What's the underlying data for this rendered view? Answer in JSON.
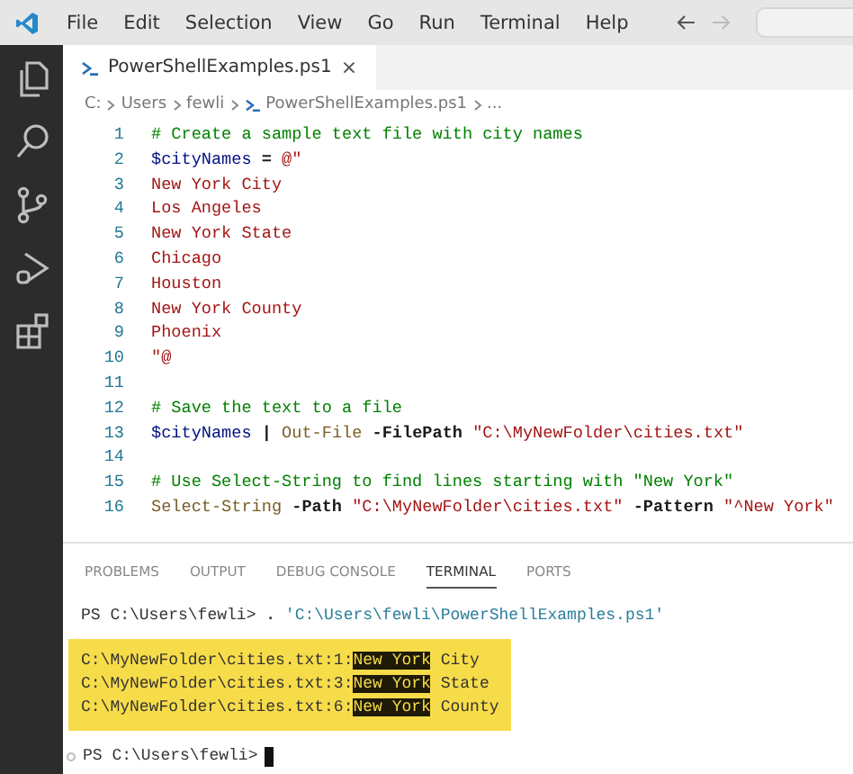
{
  "menu": {
    "items": [
      "File",
      "Edit",
      "Selection",
      "View",
      "Go",
      "Run",
      "Terminal",
      "Help"
    ]
  },
  "editor": {
    "tabs": [
      {
        "label": "PowerShellExamples.ps1",
        "selected": true,
        "close": "×"
      }
    ],
    "breadcrumb": [
      "C:",
      "Users",
      "fewli",
      "PowerShellExamples.ps1",
      "..."
    ],
    "lines": [
      {
        "number": "1",
        "tokens": [
          {
            "kind": "comment",
            "text": "# Create a sample text file with city names"
          }
        ]
      },
      {
        "number": "2",
        "tokens": [
          {
            "kind": "variable",
            "text": "$cityNames"
          },
          {
            "kind": "plain",
            "text": " = "
          },
          {
            "kind": "string",
            "text": "@\""
          }
        ]
      },
      {
        "number": "3",
        "tokens": [
          {
            "kind": "string",
            "text": "New York City"
          }
        ]
      },
      {
        "number": "4",
        "tokens": [
          {
            "kind": "string",
            "text": "Los Angeles"
          }
        ]
      },
      {
        "number": "5",
        "tokens": [
          {
            "kind": "string",
            "text": "New York State"
          }
        ]
      },
      {
        "number": "6",
        "tokens": [
          {
            "kind": "string",
            "text": "Chicago"
          }
        ]
      },
      {
        "number": "7",
        "tokens": [
          {
            "kind": "string",
            "text": "Houston"
          }
        ]
      },
      {
        "number": "8",
        "tokens": [
          {
            "kind": "string",
            "text": "New York County"
          }
        ]
      },
      {
        "number": "9",
        "tokens": [
          {
            "kind": "string",
            "text": "Phoenix"
          }
        ]
      },
      {
        "number": "10",
        "tokens": [
          {
            "kind": "string",
            "text": "\"@"
          }
        ]
      },
      {
        "number": "11"
      },
      {
        "number": "12",
        "tokens": [
          {
            "kind": "comment",
            "text": "# Save the text to a file"
          }
        ]
      },
      {
        "number": "13",
        "tokens": [
          {
            "kind": "variable",
            "text": "$cityNames"
          },
          {
            "kind": "plain",
            "text": " | "
          },
          {
            "kind": "command",
            "text": "Out-File"
          },
          {
            "kind": "plain",
            "text": " -FilePath "
          },
          {
            "kind": "string",
            "text": "\"C:\\MyNewFolder\\cities.txt\""
          }
        ]
      },
      {
        "number": "14"
      },
      {
        "number": "15",
        "tokens": [
          {
            "kind": "comment",
            "text": "# Use Select-String to find lines starting with \"New York\""
          }
        ]
      },
      {
        "number": "16",
        "tokens": [
          {
            "kind": "command",
            "text": "Select-String"
          },
          {
            "kind": "plain",
            "text": " -Path "
          },
          {
            "kind": "string",
            "text": "\"C:\\MyNewFolder\\cities.txt\""
          },
          {
            "kind": "plain",
            "text": " -Pattern "
          },
          {
            "kind": "string",
            "text": "\"^New York\""
          }
        ]
      }
    ]
  },
  "panel": {
    "tabs": [
      {
        "label": "PROBLEMS",
        "selected": false
      },
      {
        "label": "OUTPUT",
        "selected": false
      },
      {
        "label": "DEBUG CONSOLE",
        "selected": false
      },
      {
        "label": "TERMINAL",
        "selected": true
      },
      {
        "label": "PORTS",
        "selected": false
      }
    ],
    "terminal": {
      "command": {
        "prompt": "PS C:\\Users\\fewli>",
        "operator": " . ",
        "string": "'C:\\Users\\fewli\\PowerShellExamples.ps1'"
      },
      "output": {
        "highlighted": true,
        "lines": [
          {
            "prefix": "C:\\MyNewFolder\\cities.txt:1:",
            "match": "New York",
            "suffix": " City"
          },
          {
            "prefix": "C:\\MyNewFolder\\cities.txt:3:",
            "match": "New York",
            "suffix": " State"
          },
          {
            "prefix": "C:\\MyNewFolder\\cities.txt:6:",
            "match": "New York",
            "suffix": " County"
          }
        ]
      },
      "prompt": "PS C:\\Users\\fewli>"
    }
  }
}
